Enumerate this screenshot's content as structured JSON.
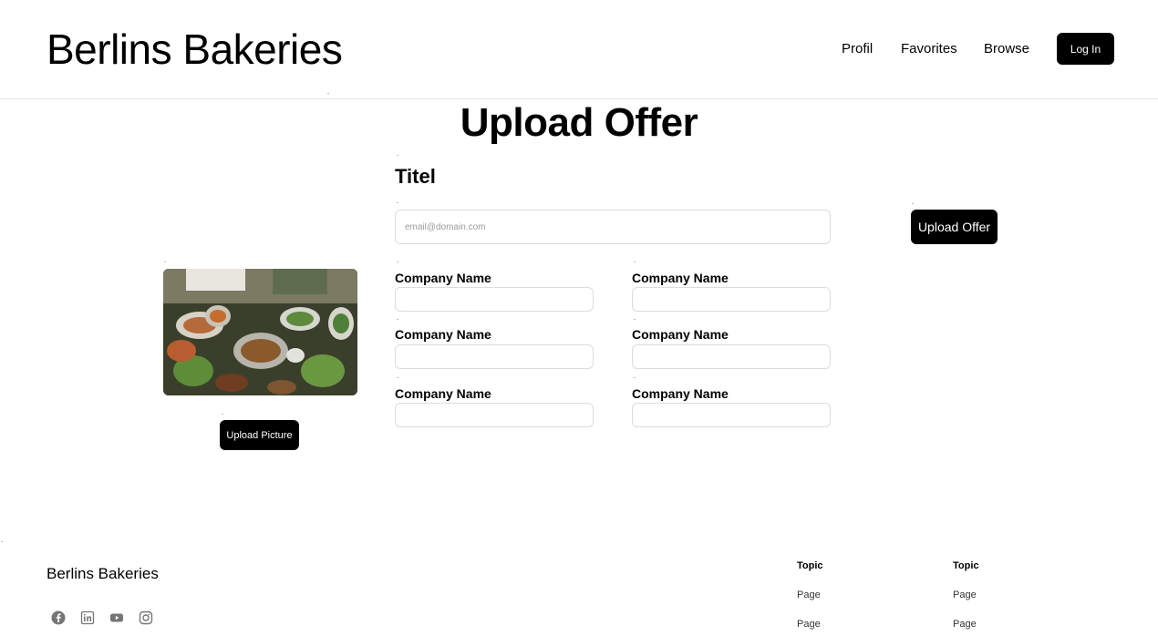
{
  "header": {
    "brand": "Berlins Bakeries",
    "nav": {
      "profil": "Profil",
      "favorites": "Favorites",
      "browse": "Browse"
    },
    "login_label": "Log In"
  },
  "main": {
    "title": "Upload Offer",
    "titel_label": "Titel",
    "titel_placeholder": "email@domain.com",
    "upload_offer_label": "Upload Offer",
    "upload_picture_label": "Upload Picture",
    "fields": [
      {
        "label": "Company Name",
        "value": ""
      },
      {
        "label": "Company Name",
        "value": ""
      },
      {
        "label": "Company Name",
        "value": ""
      },
      {
        "label": "Company Name",
        "value": ""
      },
      {
        "label": "Company Name",
        "value": ""
      },
      {
        "label": "Company Name",
        "value": ""
      }
    ]
  },
  "footer": {
    "brand": "Berlins Bakeries",
    "social_icons": [
      "facebook-icon",
      "linkedin-icon",
      "youtube-icon",
      "instagram-icon"
    ],
    "columns": [
      {
        "topic": "Topic",
        "pages": [
          "Page",
          "Page"
        ]
      },
      {
        "topic": "Topic",
        "pages": [
          "Page",
          "Page"
        ]
      }
    ]
  },
  "colors": {
    "button_bg": "#000000",
    "button_text": "#ffffff",
    "border": "#dcdcdc",
    "social_icon": "#757575"
  }
}
